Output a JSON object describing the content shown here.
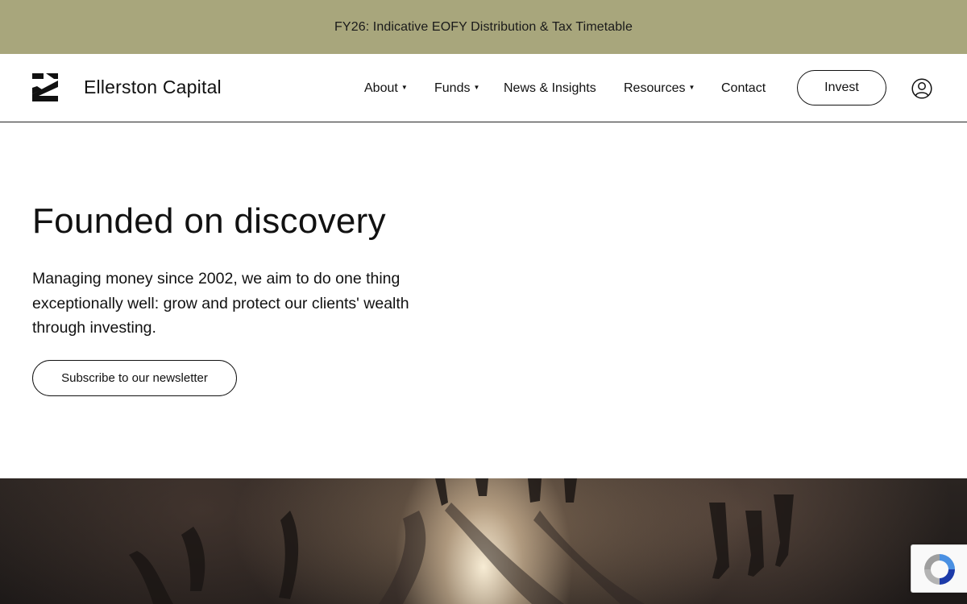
{
  "announcement": {
    "text": "FY26: Indicative EOFY Distribution & Tax Timetable"
  },
  "header": {
    "brand": "Ellerston Capital",
    "logo_icon": "ellerston-z-logo",
    "nav": [
      {
        "label": "About",
        "has_dropdown": true
      },
      {
        "label": "Funds",
        "has_dropdown": true
      },
      {
        "label": "News & Insights",
        "has_dropdown": false
      },
      {
        "label": "Resources",
        "has_dropdown": true
      },
      {
        "label": "Contact",
        "has_dropdown": false
      }
    ],
    "invest_label": "Invest",
    "account_icon": "user-circle-icon"
  },
  "hero": {
    "title": "Founded on discovery",
    "body": "Managing money since 2002, we aim to do one thing exceptionally well: grow and protect our clients' wealth through investing.",
    "subscribe_label": "Subscribe to our newsletter"
  },
  "colors": {
    "announcement_bg": "#a8a67c",
    "text": "#111111",
    "background": "#ffffff"
  },
  "widgets": {
    "recaptcha_icon": "recaptcha-icon"
  }
}
